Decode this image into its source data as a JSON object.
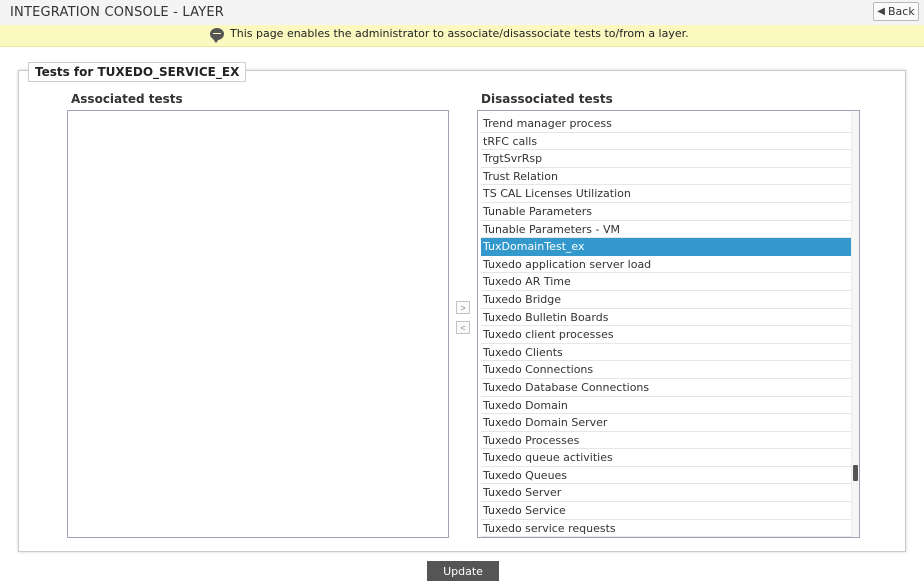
{
  "header": {
    "title": "INTEGRATION CONSOLE - LAYER",
    "back_label": "Back"
  },
  "notice": {
    "text": "This page enables the administrator to associate/disassociate tests to/from a layer."
  },
  "panel": {
    "legend": "Tests for TUXEDO_SERVICE_EX",
    "associated_label": "Associated tests",
    "disassociated_label": "Disassociated tests",
    "associated_items": [],
    "disassociated_items": [
      "Trend manager process",
      "tRFC calls",
      "TrgtSvrRsp",
      "Trust Relation",
      "TS CAL Licenses Utilization",
      "Tunable Parameters",
      "Tunable Parameters - VM",
      "TuxDomainTest_ex",
      "Tuxedo application server load",
      "Tuxedo AR Time",
      "Tuxedo Bridge",
      "Tuxedo Bulletin Boards",
      "Tuxedo client processes",
      "Tuxedo Clients",
      "Tuxedo Connections",
      "Tuxedo Database Connections",
      "Tuxedo Domain",
      "Tuxedo Domain Server",
      "Tuxedo Processes",
      "Tuxedo queue activities",
      "Tuxedo Queues",
      "Tuxedo Server",
      "Tuxedo Service",
      "Tuxedo service requests"
    ],
    "selected_item": "TuxDomainTest_ex",
    "move_right_label": ">",
    "move_left_label": "<"
  },
  "footer": {
    "update_label": "Update"
  },
  "colors": {
    "selected_bg": "#3399cc",
    "notice_bg": "#fbf9c0",
    "update_bg": "#555555"
  }
}
